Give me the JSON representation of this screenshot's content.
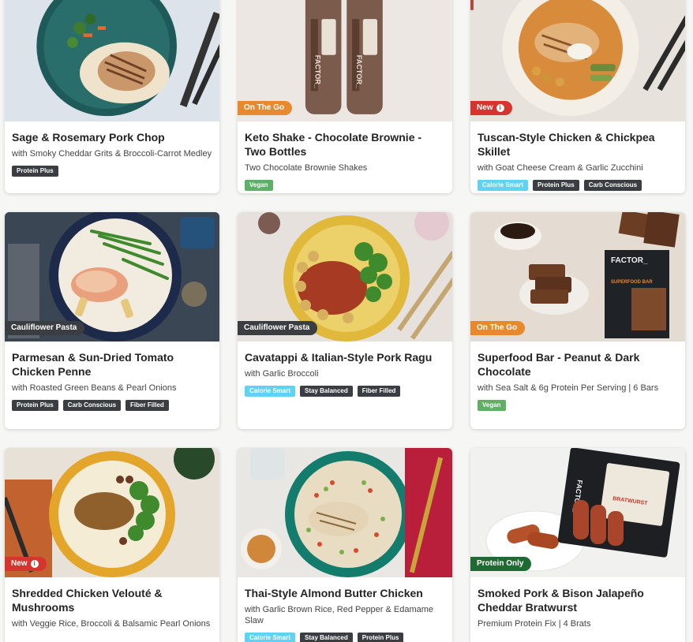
{
  "colors": {
    "flag_orange": "#e8892d",
    "flag_red": "#d6342f",
    "flag_dark": "#3a3d42",
    "flag_green": "#1f6a33",
    "tag_dark": "#3a3d42",
    "tag_green": "#5db066",
    "tag_cyan": "#5fd3f2"
  },
  "meals": [
    {
      "title": "Sage & Rosemary Pork Chop",
      "subtitle": "with Smoky Cheddar Grits & Broccoli-Carrot Medley",
      "flag": null,
      "tags": [
        {
          "label": "Protein Plus",
          "color": "dark"
        }
      ]
    },
    {
      "title": "Keto Shake - Chocolate Brownie - Two Bottles",
      "subtitle": "Two Chocolate Brownie Shakes",
      "flag": {
        "label": "On The Go",
        "color": "orange"
      },
      "tags": [
        {
          "label": "Vegan",
          "color": "green"
        }
      ],
      "bottle_text": "FACTOR_"
    },
    {
      "title": "Tuscan-Style Chicken & Chickpea Skillet",
      "subtitle": "with Goat Cheese Cream & Garlic Zucchini",
      "flag": {
        "label": "New",
        "color": "red",
        "info": "i"
      },
      "tags": [
        {
          "label": "Calorie Smart",
          "color": "cyan"
        },
        {
          "label": "Protein Plus",
          "color": "dark"
        },
        {
          "label": "Carb Conscious",
          "color": "dark"
        }
      ]
    },
    {
      "title": "Parmesan & Sun-Dried Tomato Chicken Penne",
      "subtitle": "with Roasted Green Beans & Pearl Onions",
      "flag": {
        "label": "Cauliflower Pasta",
        "color": "dark"
      },
      "tags": [
        {
          "label": "Protein Plus",
          "color": "dark"
        },
        {
          "label": "Carb Conscious",
          "color": "dark"
        },
        {
          "label": "Fiber Filled",
          "color": "dark"
        }
      ]
    },
    {
      "title": "Cavatappi & Italian-Style Pork Ragu",
      "subtitle": "with Garlic Broccoli",
      "flag": {
        "label": "Cauliflower Pasta",
        "color": "dark"
      },
      "tags": [
        {
          "label": "Calorie Smart",
          "color": "cyan"
        },
        {
          "label": "Stay Balanced",
          "color": "dark"
        },
        {
          "label": "Fiber Filled",
          "color": "dark"
        }
      ]
    },
    {
      "title": "Superfood Bar - Peanut & Dark Chocolate",
      "subtitle": "with Sea Salt & 6g Protein Per Serving | 6 Bars",
      "flag": {
        "label": "On The Go",
        "color": "orange"
      },
      "tags": [
        {
          "label": "Vegan",
          "color": "green"
        }
      ],
      "box_text": "FACTOR_",
      "box_subtext": "SUPERFOOD BAR"
    },
    {
      "title": "Shredded Chicken Velouté & Mushrooms",
      "subtitle": "with Veggie Rice, Broccoli & Balsamic Pearl Onions",
      "flag": {
        "label": "New",
        "color": "red",
        "info": "i"
      },
      "tags": []
    },
    {
      "title": "Thai-Style Almond Butter Chicken",
      "subtitle": "with Garlic Brown Rice, Red Pepper & Edamame Slaw",
      "flag": null,
      "tags": [
        {
          "label": "Calorie Smart",
          "color": "cyan"
        },
        {
          "label": "Stay Balanced",
          "color": "dark"
        },
        {
          "label": "Protein Plus",
          "color": "dark"
        }
      ]
    },
    {
      "title": "Smoked Pork & Bison Jalapeño Cheddar Bratwurst",
      "subtitle": "Premium Protein Fix | 4 Brats",
      "flag": {
        "label": "Protein Only",
        "color": "green"
      },
      "tags": [],
      "pack_text": "FACTOR_",
      "pack_label": "BRATWURST"
    }
  ]
}
